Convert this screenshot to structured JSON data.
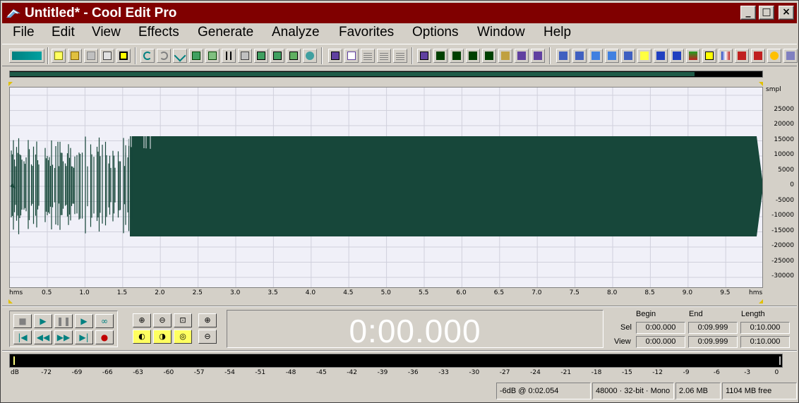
{
  "window": {
    "title": "Untitled* - Cool Edit Pro",
    "minimize": "_",
    "maximize": "□",
    "close": "×"
  },
  "menu": [
    "File",
    "Edit",
    "View",
    "Effects",
    "Generate",
    "Analyze",
    "Favorites",
    "Options",
    "Window",
    "Help"
  ],
  "waveform": {
    "y_unit": "smpl",
    "y_ticks": [
      "25000",
      "20000",
      "15000",
      "10000",
      "5000",
      "0",
      "-5000",
      "-10000",
      "-15000",
      "-20000",
      "-25000",
      "-30000"
    ],
    "x_unit": "hms",
    "x_ticks": [
      "0.5",
      "1.0",
      "1.5",
      "2.0",
      "2.5",
      "3.0",
      "3.5",
      "4.0",
      "4.5",
      "5.0",
      "5.5",
      "6.0",
      "6.5",
      "7.0",
      "7.5",
      "8.0",
      "8.5",
      "9.0",
      "9.5"
    ],
    "wave_color": "#17473a",
    "background_color": "#f0f0f8",
    "overview_progress": 0.91
  },
  "transport": {
    "stop": "■",
    "play": "▶",
    "pause": "❚❚",
    "play_to_end": "▶",
    "loop": "∞",
    "goto_start": "|◀",
    "rewind": "◀◀",
    "ffwd": "▶▶",
    "goto_end": "▶|",
    "record": "●"
  },
  "time_display": "0:00.000",
  "selection": {
    "headers": {
      "begin": "Begin",
      "end": "End",
      "length": "Length"
    },
    "sel": {
      "label": "Sel",
      "begin": "0:00.000",
      "end": "0:09.999",
      "length": "0:10.000"
    },
    "view": {
      "label": "View",
      "begin": "0:00.000",
      "end": "0:09.999",
      "length": "0:10.000"
    }
  },
  "meter_scale": [
    "dB",
    "-72",
    "-69",
    "-66",
    "-63",
    "-60",
    "-57",
    "-54",
    "-51",
    "-48",
    "-45",
    "-42",
    "-39",
    "-36",
    "-33",
    "-30",
    "-27",
    "-24",
    "-21",
    "-18",
    "-15",
    "-12",
    "-9",
    "-6",
    "-3",
    "0"
  ],
  "status": {
    "level": "-6dB @   0:02.054",
    "format": "48000 · 32-bit · Mono",
    "size": "2.06 MB",
    "free": "1104 MB free"
  }
}
